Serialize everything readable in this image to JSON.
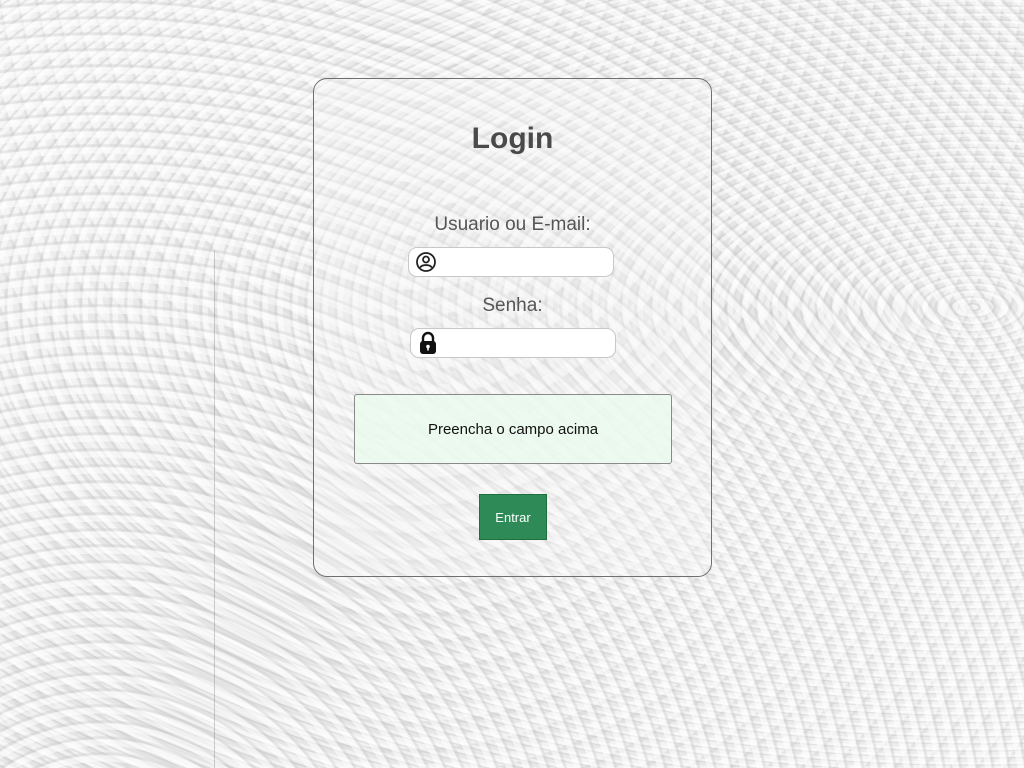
{
  "login": {
    "title": "Login",
    "username_label": "Usuario ou E-mail:",
    "username_value": "",
    "username_icon": "user-circle-icon",
    "password_label": "Senha:",
    "password_value": "",
    "password_icon": "padlock-icon",
    "message": "Preencha o campo acima",
    "submit_label": "Entrar"
  },
  "colors": {
    "accent": "#2e8b57",
    "message_background": "#ebfaee",
    "title_text": "#4a4a4a"
  }
}
